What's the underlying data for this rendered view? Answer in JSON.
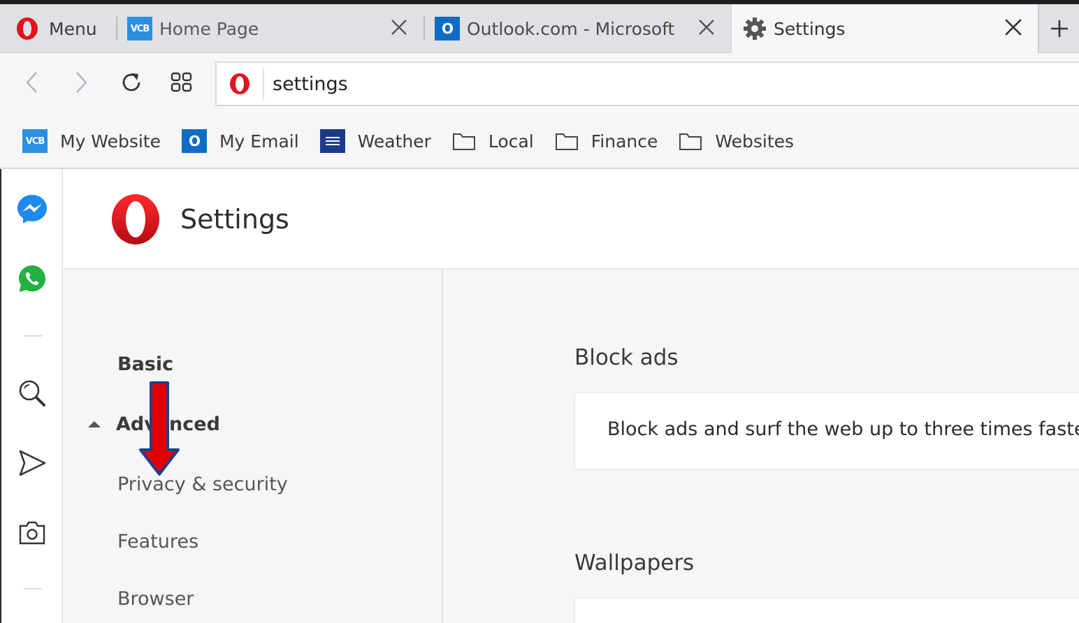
{
  "tabs": {
    "menu_label": "Menu",
    "items": [
      {
        "label": "Home Page",
        "icon": "vcb-icon"
      },
      {
        "label": "Outlook.com - Microsoft f",
        "icon": "outlook-icon"
      },
      {
        "label": "Settings",
        "icon": "gear-icon",
        "active": true
      }
    ]
  },
  "address": {
    "value": "settings"
  },
  "bookmarks": [
    {
      "label": "My Website",
      "icon": "vcb-icon"
    },
    {
      "label": "My Email",
      "icon": "outlook-icon"
    },
    {
      "label": "Weather",
      "icon": "weather-channel-icon"
    },
    {
      "label": "Local",
      "icon": "folder-icon"
    },
    {
      "label": "Finance",
      "icon": "folder-icon"
    },
    {
      "label": "Websites",
      "icon": "folder-icon"
    }
  ],
  "icons": {
    "vcb_text": "VCB",
    "outlook_text": "O"
  },
  "sidebar": [
    "messenger-icon",
    "whatsapp-icon",
    "search-icon",
    "send-icon",
    "camera-icon"
  ],
  "settings": {
    "title": "Settings",
    "nav": {
      "basic": "Basic",
      "advanced": "Advanced",
      "privacy": "Privacy & security",
      "features": "Features",
      "browser": "Browser"
    },
    "sections": {
      "block_ads_title": "Block ads",
      "block_ads_text": "Block ads and surf the web up to three times faster",
      "wallpapers_title": "Wallpapers"
    }
  },
  "colors": {
    "opera_red": "#e0141e",
    "annotation_arrow": "#e00000",
    "annotation_outline": "#1f3f8a"
  }
}
